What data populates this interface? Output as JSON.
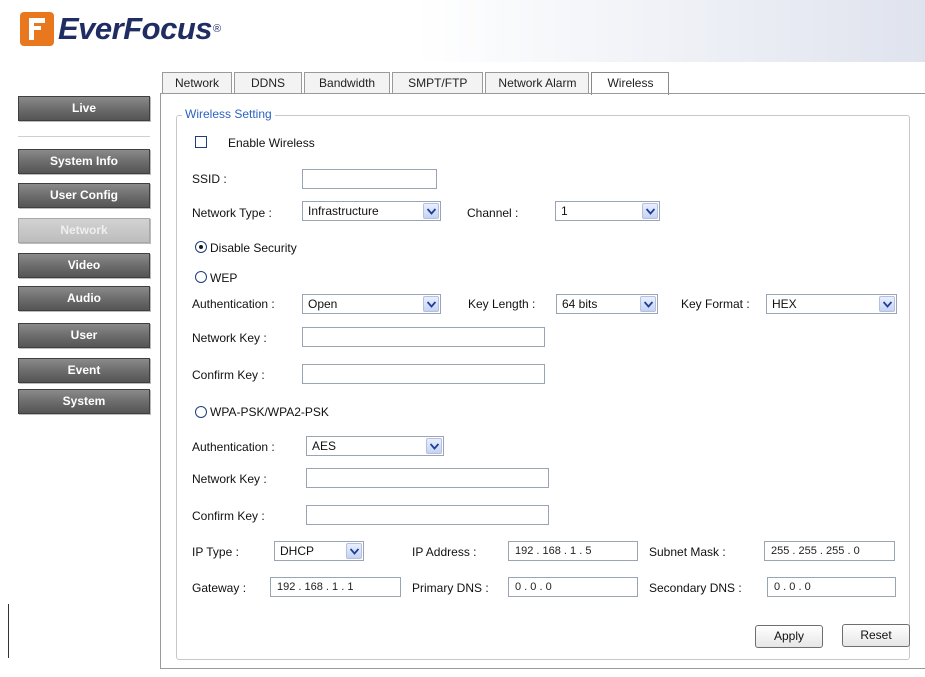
{
  "brand": {
    "name": "EverFocus",
    "reg_mark": "®",
    "accent_color": "#e8771e",
    "text_color": "#1f2d63"
  },
  "sidebar": {
    "items": [
      {
        "label": "Live"
      },
      {
        "label": "System Info"
      },
      {
        "label": "User Config"
      },
      {
        "label": "Network",
        "active": true
      },
      {
        "label": "Video"
      },
      {
        "label": "Audio"
      },
      {
        "label": "User"
      },
      {
        "label": "Event"
      },
      {
        "label": "System"
      }
    ]
  },
  "tabs": [
    {
      "label": "Network"
    },
    {
      "label": "DDNS"
    },
    {
      "label": "Bandwidth"
    },
    {
      "label": "SMPT/FTP"
    },
    {
      "label": "Network Alarm"
    },
    {
      "label": "Wireless",
      "active": true
    }
  ],
  "wireless": {
    "legend": "Wireless Setting",
    "enable_label": "Enable Wireless",
    "enable_checked": false,
    "ssid_label": "SSID :",
    "ssid_value": "",
    "network_type_label": "Network Type :",
    "network_type_value": "Infrastructure",
    "channel_label": "Channel :",
    "channel_value": "1",
    "security": {
      "disable_label": "Disable Security",
      "wep_label": "WEP",
      "wpa_label": "WPA-PSK/WPA2-PSK",
      "selected": "disable"
    },
    "wep": {
      "auth_label": "Authentication :",
      "auth_value": "Open",
      "key_length_label": "Key Length :",
      "key_length_value": "64 bits",
      "key_format_label": "Key Format :",
      "key_format_value": "HEX",
      "network_key_label": "Network Key :",
      "network_key_value": "",
      "confirm_key_label": "Confirm Key :",
      "confirm_key_value": ""
    },
    "wpa": {
      "auth_label": "Authentication :",
      "auth_value": "AES",
      "network_key_label": "Network Key :",
      "network_key_value": "",
      "confirm_key_label": "Confirm Key :",
      "confirm_key_value": ""
    },
    "ip": {
      "ip_type_label": "IP Type :",
      "ip_type_value": "DHCP",
      "ip_address_label": "IP Address :",
      "ip_address_value": "192 . 168 . 1 . 5",
      "subnet_label": "Subnet Mask :",
      "subnet_value": "255 . 255 . 255 . 0",
      "gateway_label": "Gateway :",
      "gateway_value": "192 . 168 . 1 . 1",
      "primary_dns_label": "Primary DNS :",
      "primary_dns_value": "0   .   0   .   0",
      "secondary_dns_label": "Secondary DNS :",
      "secondary_dns_value": "0   .   0   .   0"
    },
    "apply_label": "Apply",
    "reset_label": "Reset"
  }
}
